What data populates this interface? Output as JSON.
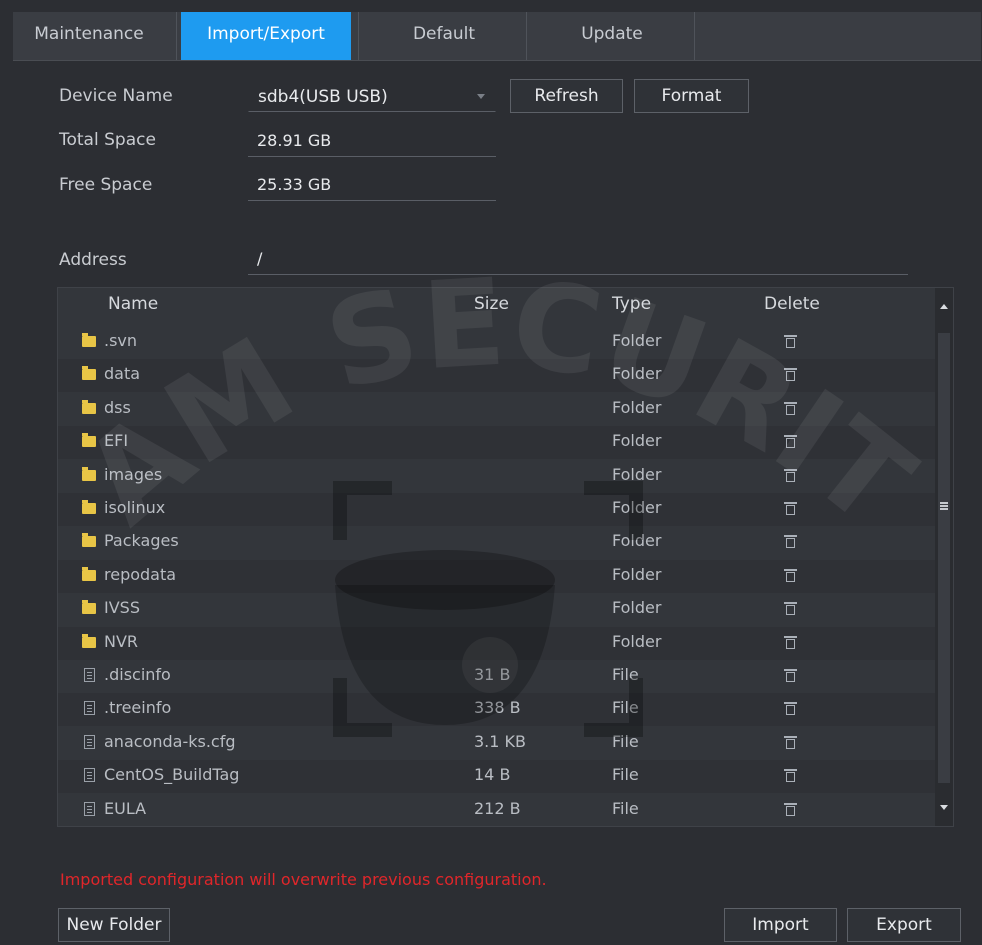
{
  "tabs": [
    "Maintenance",
    "Import/Export",
    "Default",
    "Update"
  ],
  "active_tab": "Import/Export",
  "device": {
    "name_label": "Device Name",
    "name_value": "sdb4(USB USB)",
    "refresh_label": "Refresh",
    "format_label": "Format",
    "total_label": "Total Space",
    "total_value": "28.91 GB",
    "free_label": "Free Space",
    "free_value": "25.33 GB",
    "address_label": "Address",
    "address_value": "/"
  },
  "table": {
    "headers": [
      "Name",
      "Size",
      "Type",
      "Delete"
    ],
    "rows": [
      {
        "name": ".svn",
        "size": "",
        "type": "Folder",
        "icon": "folder-icon"
      },
      {
        "name": "data",
        "size": "",
        "type": "Folder",
        "icon": "folder-icon"
      },
      {
        "name": "dss",
        "size": "",
        "type": "Folder",
        "icon": "folder-icon"
      },
      {
        "name": "EFI",
        "size": "",
        "type": "Folder",
        "icon": "folder-icon"
      },
      {
        "name": "images",
        "size": "",
        "type": "Folder",
        "icon": "folder-icon"
      },
      {
        "name": "isolinux",
        "size": "",
        "type": "Folder",
        "icon": "folder-icon"
      },
      {
        "name": "Packages",
        "size": "",
        "type": "Folder",
        "icon": "folder-icon"
      },
      {
        "name": "repodata",
        "size": "",
        "type": "Folder",
        "icon": "folder-icon"
      },
      {
        "name": "IVSS",
        "size": "",
        "type": "Folder",
        "icon": "folder-icon"
      },
      {
        "name": "NVR",
        "size": "",
        "type": "Folder",
        "icon": "folder-icon"
      },
      {
        "name": ".discinfo",
        "size": "31 B",
        "type": "File",
        "icon": "file-icon"
      },
      {
        "name": ".treeinfo",
        "size": "338 B",
        "type": "File",
        "icon": "file-icon"
      },
      {
        "name": "anaconda-ks.cfg",
        "size": "3.1 KB",
        "type": "File",
        "icon": "file-icon"
      },
      {
        "name": "CentOS_BuildTag",
        "size": "14 B",
        "type": "File",
        "icon": "file-icon"
      },
      {
        "name": "EULA",
        "size": "212 B",
        "type": "File",
        "icon": "file-icon"
      }
    ]
  },
  "warning": "Imported configuration will overwrite previous configuration.",
  "footer": {
    "new_folder_label": "New Folder",
    "import_label": "Import",
    "export_label": "Export"
  },
  "watermark_text": "SAM SECURITY",
  "colors": {
    "accent": "#1e9bf0",
    "warning": "#e0262a",
    "folder": "#e8c546",
    "background": "#2c2e33"
  }
}
